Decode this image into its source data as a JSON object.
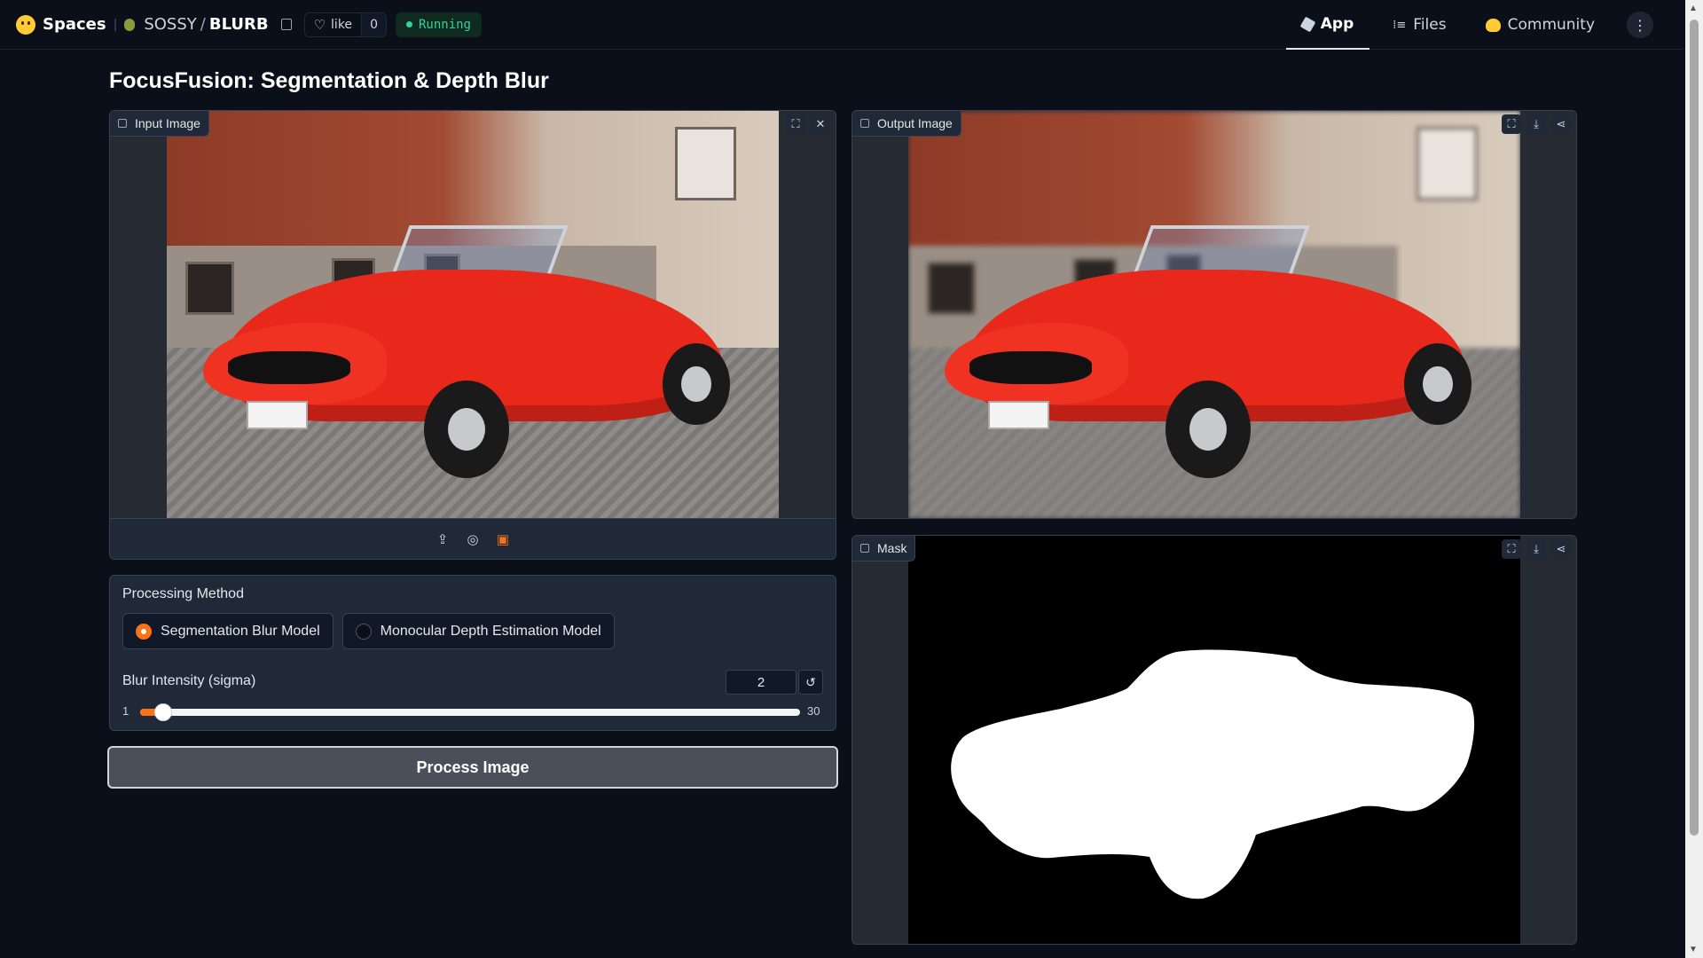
{
  "topbar": {
    "brand": "Spaces",
    "repo_owner": "SOSSY",
    "repo_slash": "/",
    "repo_name": "BLURB",
    "like_label": "like",
    "like_count": "0",
    "status": "Running",
    "nav": [
      {
        "label": "App",
        "icon": "cube-icon",
        "active": true
      },
      {
        "label": "Files",
        "icon": "files-icon",
        "active": false
      },
      {
        "label": "Community",
        "icon": "community-icon",
        "active": false
      }
    ]
  },
  "page": {
    "title": "FocusFusion: Segmentation & Depth Blur"
  },
  "input_image": {
    "label": "Input Image"
  },
  "output_image": {
    "label": "Output Image"
  },
  "mask": {
    "label": "Mask"
  },
  "controls": {
    "method_label": "Processing Method",
    "methods": [
      {
        "label": "Segmentation Blur Model",
        "selected": true
      },
      {
        "label": "Monocular Depth Estimation Model",
        "selected": false
      }
    ],
    "blur_label": "Blur Intensity (sigma)",
    "blur_value": "2",
    "blur_min": "1",
    "blur_max": "30",
    "blur_fraction": 0.0345
  },
  "process_button": "Process Image",
  "colors": {
    "accent": "#f97316",
    "background": "#0b0f19",
    "panel": "#1f2937",
    "running": "#34d399"
  }
}
